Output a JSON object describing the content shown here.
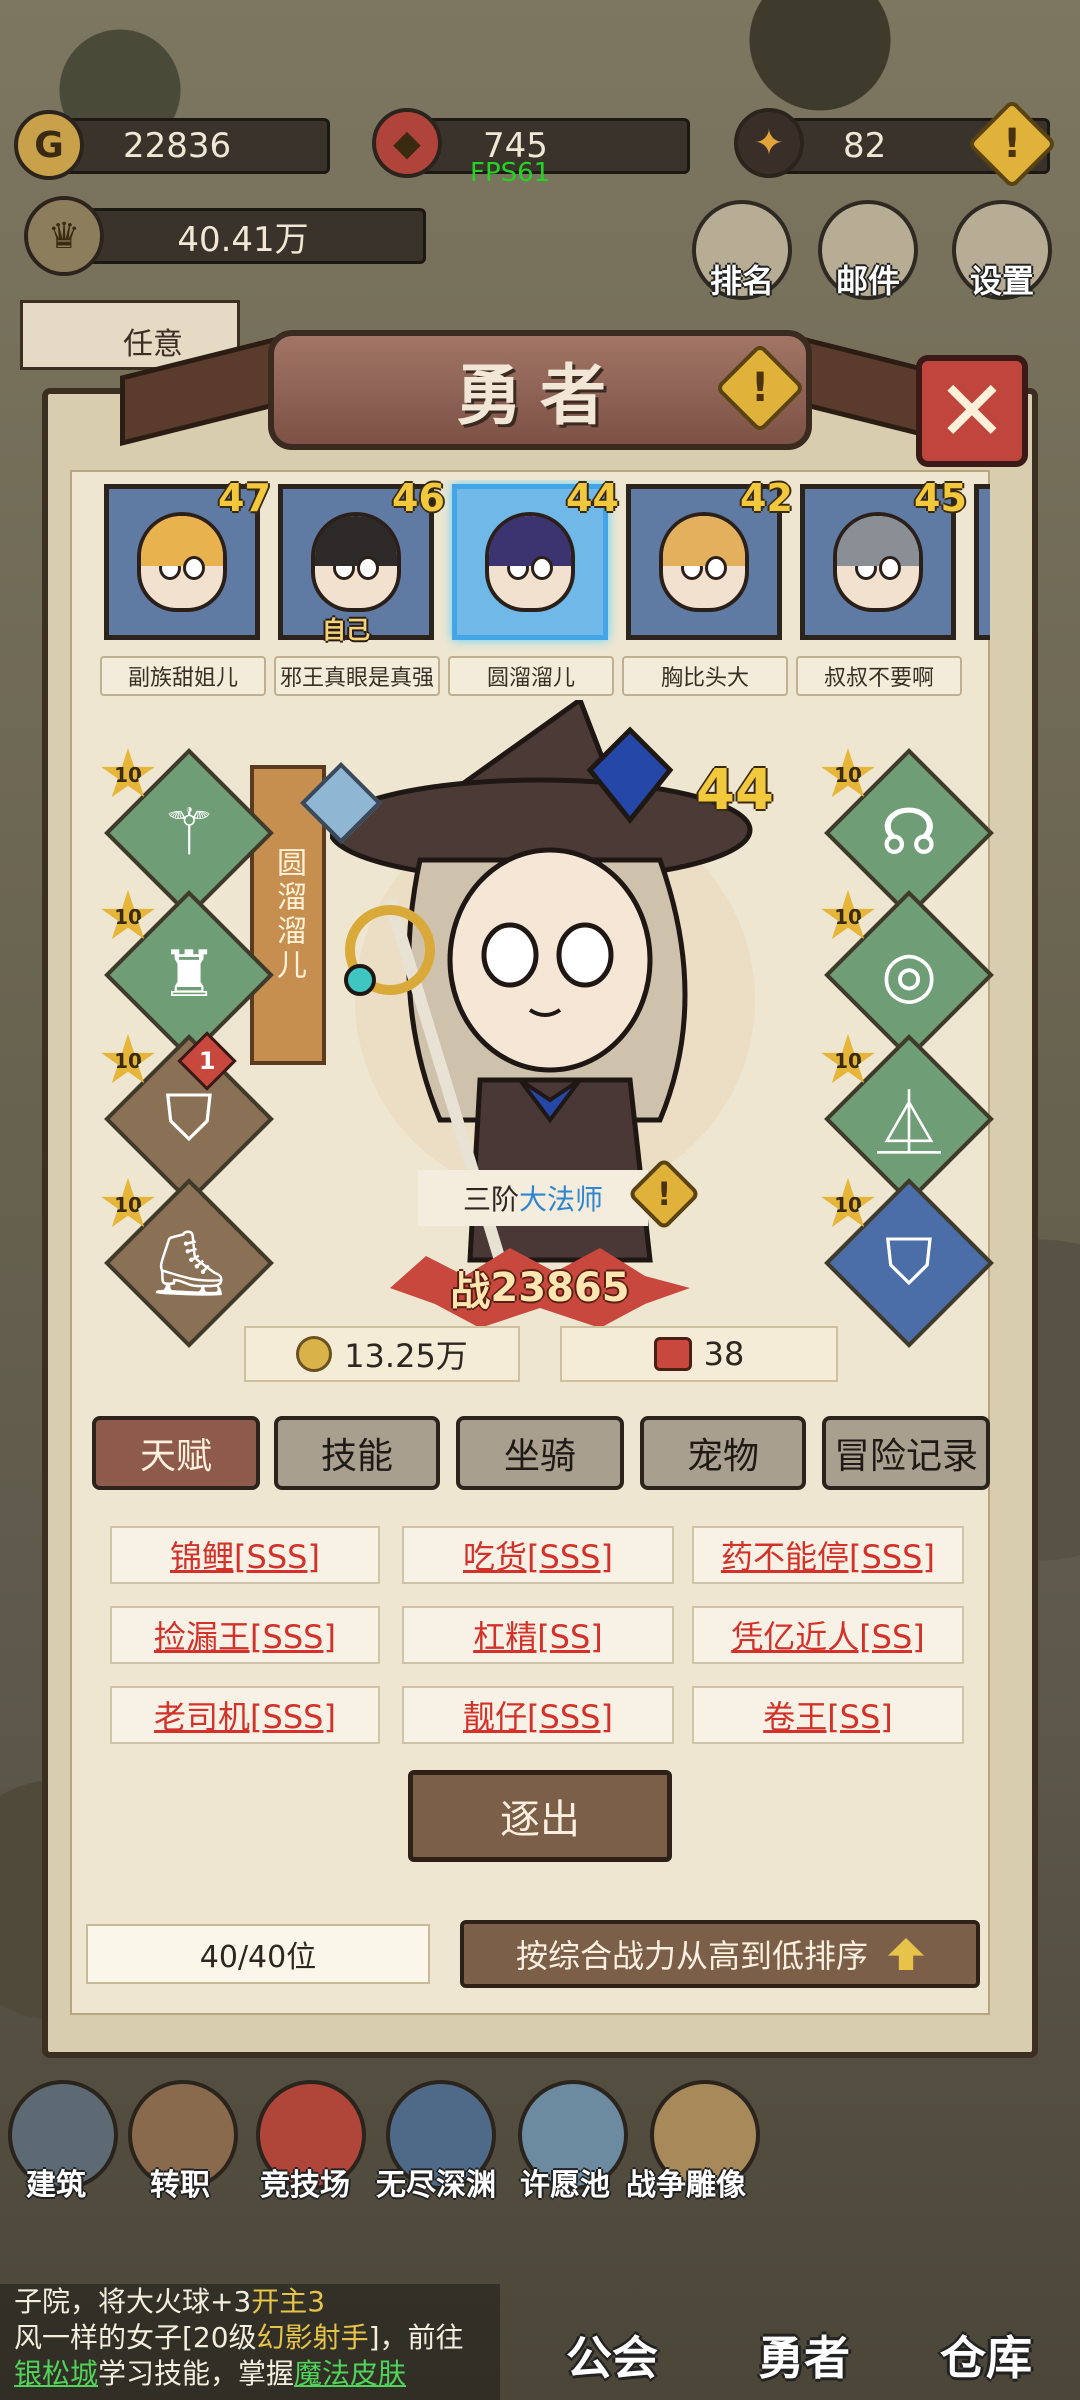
{
  "resources": {
    "gold": "22836",
    "gems": "745",
    "energy": "82",
    "power_total": "40.41万"
  },
  "fps": "FPS61",
  "top_buttons": {
    "ranking": "排名",
    "mail": "邮件",
    "settings": "设置"
  },
  "partial_left": "任意",
  "panel": {
    "title": "勇者",
    "close": "✕"
  },
  "heroes": [
    {
      "level": "47",
      "name": "副族甜姐儿",
      "hair": "#e8b24e",
      "tag": ""
    },
    {
      "level": "46",
      "name": "邪王真眼是真强",
      "hair": "#2f2a2a",
      "tag": "自己"
    },
    {
      "level": "44",
      "name": "圆溜溜儿",
      "hair": "#3c3470",
      "tag": ""
    },
    {
      "level": "42",
      "name": "胸比头大",
      "hair": "#e3b15e",
      "tag": ""
    },
    {
      "level": "45",
      "name": "叔叔不要啊",
      "hair": "#8a8e95",
      "tag": ""
    }
  ],
  "selected_hero": {
    "name": "圆溜溜儿",
    "level": "44",
    "rank_prefix": "三阶",
    "rank_class": "大法师",
    "power_label": "战",
    "power": "23865",
    "gold_stat": "13.25万",
    "item_stat": "38"
  },
  "equipment_left": [
    {
      "stars": "10",
      "icon": "⚚",
      "color": "green"
    },
    {
      "stars": "10",
      "icon": "♜",
      "color": "green"
    },
    {
      "stars": "10",
      "icon": "⛉",
      "color": "brown",
      "badge": "1"
    },
    {
      "stars": "10",
      "icon": "⛸",
      "color": "brown"
    }
  ],
  "equipment_right": [
    {
      "stars": "10",
      "icon": "☊",
      "color": "green"
    },
    {
      "stars": "10",
      "icon": "◎",
      "color": "green"
    },
    {
      "stars": "10",
      "icon": "⏅",
      "color": "green"
    },
    {
      "stars": "10",
      "icon": "⛉",
      "color": "blue"
    }
  ],
  "tabs": [
    "天赋",
    "技能",
    "坐骑",
    "宠物",
    "冒险记录"
  ],
  "talents": [
    "锦鲤[SSS]",
    "吃货[SSS]",
    "药不能停[SSS]",
    "捡漏王[SSS]",
    "杠精[SS]",
    "凭亿近人[SS]",
    "老司机[SSS]",
    "靓仔[SSS]",
    "卷王[SS]"
  ],
  "expel_button": "逐出",
  "hero_count": "40/40位",
  "sort_button": "按综合战力从高到低排序",
  "bottom_nav": [
    "建筑",
    "转职",
    "竞技场",
    "无尽深渊",
    "许愿池",
    "战争雕像"
  ],
  "chat": {
    "line1_partial": "子院，将大火球+3",
    "line1_tail": "开主3",
    "line2_pre": "风一样的女子[20级",
    "line2_class": "幻影射手",
    "line2_post": "]，前往",
    "line3_place": "银松城",
    "line3_mid": "学习技能，掌握",
    "line3_skill": "魔法皮肤"
  },
  "main_nav": [
    "公会",
    "勇者",
    "仓库"
  ]
}
